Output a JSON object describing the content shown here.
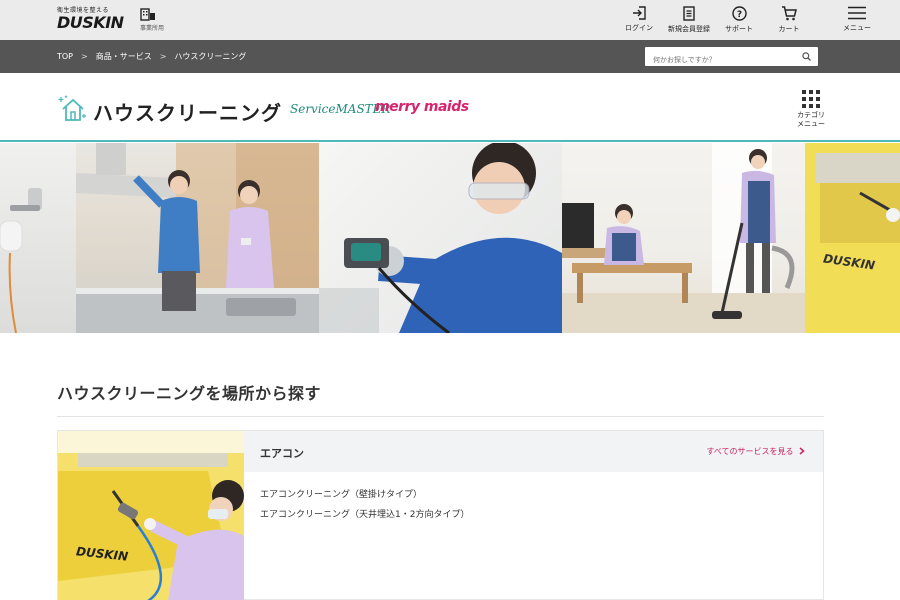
{
  "header": {
    "logo_tagline": "衛生環境を整える",
    "logo_text": "DUSKIN",
    "business_label": "事業所用",
    "nav": [
      {
        "label": "ログイン",
        "icon": "login-icon"
      },
      {
        "label": "新規会員登録",
        "icon": "register-icon"
      },
      {
        "label": "サポート",
        "icon": "help-icon"
      },
      {
        "label": "カート",
        "icon": "cart-icon"
      },
      {
        "label": "メニュー",
        "icon": "hamburger-icon"
      }
    ]
  },
  "breadcrumb": [
    "TOP",
    "商品・サービス",
    "ハウスクリーニング"
  ],
  "breadcrumb_separator": ">",
  "search": {
    "placeholder": "何かお探しですか？",
    "value": ""
  },
  "page": {
    "title": "ハウスクリーニング",
    "brand_servicemaster": "ServiceMASTER",
    "brand_merrymaids": "merry maids",
    "category_menu_line1": "カテゴリ",
    "category_menu_line2": "メニュー"
  },
  "hero": {
    "brand_on_cover": "DUSKIN"
  },
  "section": {
    "title": "ハウスクリーニングを場所から探す",
    "card": {
      "title": "エアコン",
      "link": "すべてのサービスを見る",
      "image_brand": "DUSKIN",
      "items": [
        "エアコンクリーニング（壁掛けタイプ）",
        "エアコンクリーニング（天井埋込1・2方向タイプ）"
      ]
    }
  },
  "colors": {
    "accent_teal": "#4fb9ba",
    "link_pink": "#c8255e",
    "breadcrumb_bg": "#555555",
    "header_bg": "#ebebeb",
    "cover_yellow": "#f1dd56"
  }
}
